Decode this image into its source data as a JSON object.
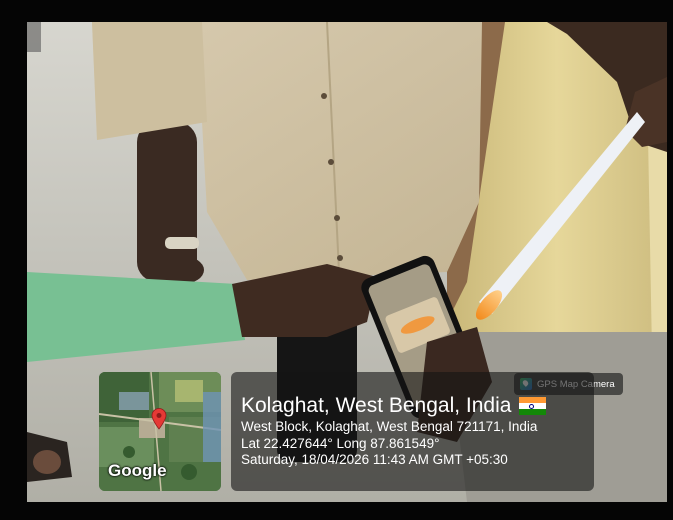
{
  "app": {
    "name": "GPS Map Camera",
    "icon": "gps-map-camera-icon"
  },
  "map": {
    "attribution": "Google",
    "marker_icon": "map-pin-icon",
    "marker_color": "#e53935"
  },
  "location": {
    "title": "Kolaghat, West Bengal, India",
    "flag": "india-flag-icon",
    "address": "West Block, Kolaghat, West Bengal 721171, India",
    "coordinates": "Lat 22.427644° Long 87.861549°",
    "datetime": "Saturday, 18/04/2026 11:43 AM GMT +05:30"
  }
}
